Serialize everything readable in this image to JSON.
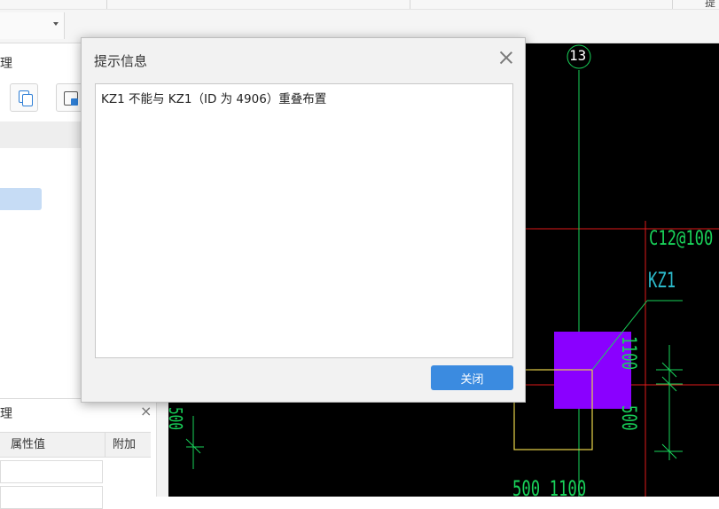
{
  "topbar": {
    "edge_text": "提"
  },
  "left_panel": {
    "header_title_fragment": "理"
  },
  "property_panel": {
    "title_fragment": "理",
    "close_glyph": "×",
    "col_value": "属性值",
    "col_extra": "附加"
  },
  "cad": {
    "axis_label": "13",
    "rebar_text": "C12@100",
    "column_label": "KZ1",
    "dim_1100": "1100",
    "dim_500_right": "500",
    "dim_500_left": "500",
    "bottom_dim": "500  1100",
    "colors": {
      "background": "#000000",
      "red_grid": "#e01a1a",
      "green": "#19d35a",
      "purple": "#8a00ff",
      "yellow": "#e8d44a",
      "cyan": "#2bb8c9"
    }
  },
  "dialog": {
    "title": "提示信息",
    "message": "KZ1 不能与 KZ1（ID 为 4906）重叠布置",
    "close_button": "关闭"
  },
  "colors": {
    "accent": "#3b8be0",
    "selection": "#c6dcf5"
  }
}
